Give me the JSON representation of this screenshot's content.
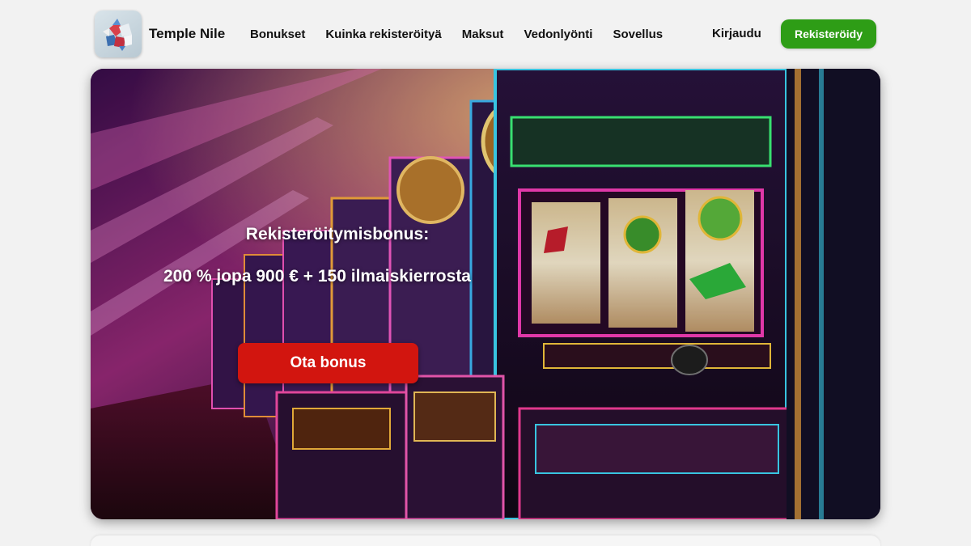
{
  "brand": {
    "name": "Temple Nile",
    "logo_icon": "gem-cluster-icon"
  },
  "nav": {
    "items": [
      {
        "label": "Bonukset"
      },
      {
        "label": "Kuinka rekisteröityä"
      },
      {
        "label": "Maksut"
      },
      {
        "label": "Vedonlyönti"
      },
      {
        "label": "Sovellus"
      }
    ]
  },
  "auth": {
    "login_label": "Kirjaudu",
    "register_label": "Rekisteröidy"
  },
  "hero": {
    "title": "Rekisteröitymisbonus:",
    "offer": "200 % jopa 900 € + 150 ilmaiskierrosta",
    "cta_label": "Ota bonus",
    "background": "casino-slot-machines-image"
  },
  "colors": {
    "register_button": "#2e9d16",
    "cta_button": "#d2150f",
    "page_background": "#f2f2f2"
  }
}
